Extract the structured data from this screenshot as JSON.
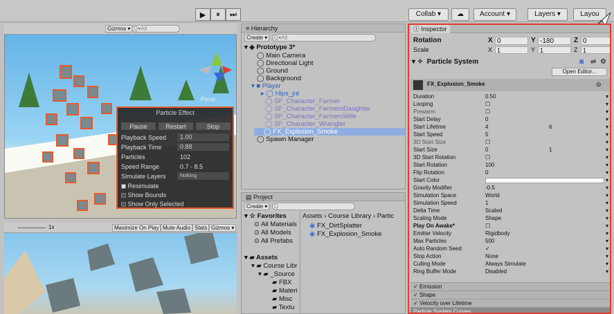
{
  "toolbar": {
    "play": "▶",
    "pause": "⏸",
    "step": "⏭",
    "collab": "Collab ▾",
    "account": "Account ▾",
    "layers": "Layers ▾",
    "layout": "Layou"
  },
  "scene": {
    "gizmos": "Gizmos ▾",
    "search_placeholder": "Q▾All",
    "persp": "Persp"
  },
  "game": {
    "scale": "1x",
    "buttons": [
      "Maximize On Play",
      "Mute Audio",
      "Stats",
      "Gizmos ▾"
    ]
  },
  "particle_effect": {
    "title": "Particle Effect",
    "tabs": [
      "Pause",
      "Restart",
      "Stop"
    ],
    "rows": [
      {
        "label": "Playback Speed",
        "value": "1.00"
      },
      {
        "label": "Playback Time",
        "value": "0.88"
      },
      {
        "label": "Particles",
        "value": "102"
      },
      {
        "label": "Speed Range",
        "value": "0.7 - 8.5"
      },
      {
        "label": "Simulate Layers",
        "value": "Nothing"
      }
    ],
    "checks": [
      "Resimulate",
      "Show Bounds",
      "Show Only Selected"
    ]
  },
  "hierarchy": {
    "title": "≡ Hierarchy",
    "create": "Create ▾",
    "search_placeholder": "Q▾All",
    "items": [
      {
        "label": "Prototype 3*",
        "indent": 0
      },
      {
        "label": "Main Camera",
        "indent": 1
      },
      {
        "label": "Directional Light",
        "indent": 1
      },
      {
        "label": "Ground",
        "indent": 1
      },
      {
        "label": "Background",
        "indent": 1
      },
      {
        "label": "Player",
        "indent": 1
      },
      {
        "label": "Hips_jnt",
        "indent": 2
      },
      {
        "label": "SF_Character_Farmer",
        "indent": 2
      },
      {
        "label": "SF_Character_FarmersDaughter",
        "indent": 2
      },
      {
        "label": "SF_Character_FarmersWife",
        "indent": 2
      },
      {
        "label": "SF_Character_Wrangler",
        "indent": 2
      },
      {
        "label": "FX_Explosion_Smoke",
        "indent": 2
      },
      {
        "label": "Spawn Manager",
        "indent": 1
      }
    ]
  },
  "project": {
    "title": "Project",
    "create": "Create ▾",
    "breadcrumb": "Assets › Course Library › Partic",
    "favorites": [
      "Favorites",
      "All Materials",
      "All Models",
      "All Prefabs"
    ],
    "assets": [
      "Assets",
      "Course Libr",
      "_Source",
      "FBX",
      "Materi",
      "Misc",
      "Textu"
    ],
    "files": [
      "FX_DirtSplatter",
      "FX_Explosion_Smoke"
    ]
  },
  "inspector": {
    "title": "Inspector",
    "rotation": {
      "label": "Rotation",
      "x": "0",
      "y": "-180",
      "z": "0"
    },
    "scale": {
      "label": "Scale",
      "x": "1",
      "y": "1",
      "z": "1"
    },
    "component": "Particle System",
    "open_editor": "Open Editor...",
    "system_name": "FX_Explosion_Smoke",
    "rows": [
      {
        "label": "Duration",
        "value": "0.50",
        "value2": ""
      },
      {
        "label": "Looping",
        "value": "☐",
        "value2": ""
      },
      {
        "label": "Prewarm",
        "value": "☐",
        "value2": ""
      },
      {
        "label": "Start Delay",
        "value": "0",
        "value2": ""
      },
      {
        "label": "Start Lifetime",
        "value": "4",
        "value2": "6"
      },
      {
        "label": "Start Speed",
        "value": "5",
        "value2": ""
      },
      {
        "label": "3D Start Size",
        "value": "☐",
        "value2": ""
      },
      {
        "label": "Start Size",
        "value": "0",
        "value2": "1"
      },
      {
        "label": "3D Start Rotation",
        "value": "☐",
        "value2": ""
      },
      {
        "label": "Start Rotation",
        "value": "100",
        "value2": ""
      },
      {
        "label": "Flip Rotation",
        "value": "0",
        "value2": ""
      },
      {
        "label": "Start Color",
        "value": "",
        "value2": ""
      },
      {
        "label": "Gravity Modifier",
        "value": "-0.5",
        "value2": ""
      },
      {
        "label": "Simulation Space",
        "value": "World",
        "value2": ""
      },
      {
        "label": "Simulation Speed",
        "value": "1",
        "value2": ""
      },
      {
        "label": "Delta Time",
        "value": "Scaled",
        "value2": ""
      },
      {
        "label": "Scaling Mode",
        "value": "Shape",
        "value2": ""
      },
      {
        "label": "Play On Awake*",
        "value": "☐",
        "value2": ""
      },
      {
        "label": "Emitter Velocity",
        "value": "Rigidbody",
        "value2": ""
      },
      {
        "label": "Max Particles",
        "value": "500",
        "value2": ""
      },
      {
        "label": "Auto Random Seed",
        "value": "✓",
        "value2": ""
      },
      {
        "label": "Stop Action",
        "value": "None",
        "value2": ""
      },
      {
        "label": "Culling Mode",
        "value": "Always Simulate",
        "value2": ""
      },
      {
        "label": "Ring Buffer Mode",
        "value": "Disabled",
        "value2": ""
      }
    ],
    "sections": [
      "Emission",
      "Shape",
      "Velocity over Lifetime",
      "Particle System Curves"
    ]
  },
  "colors": {
    "highlight": "#e03c2e",
    "selection": "#5a8bd6"
  }
}
